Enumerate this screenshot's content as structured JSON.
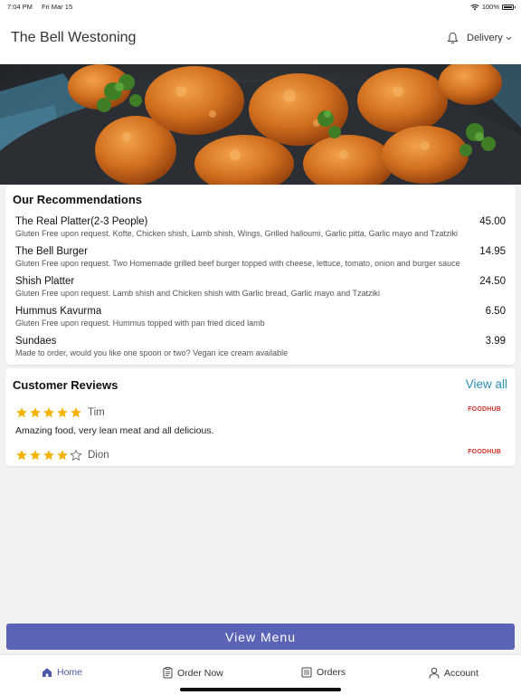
{
  "status_bar": {
    "time": "7:04 PM",
    "date": "Fri Mar 15",
    "battery": "100%"
  },
  "header": {
    "title": "The Bell Westoning",
    "mode": "Delivery"
  },
  "recommendations": {
    "title": "Our Recommendations",
    "items": [
      {
        "name": "The Real Platter(2-3 People)",
        "price": "45.00",
        "desc": "Gluten Free upon request. Kofte, Chicken shish, Lamb shish, Wings, Grilled halloumi, Garlic pitta, Garlic mayo and Tzatziki"
      },
      {
        "name": "The Bell Burger",
        "price": "14.95",
        "desc": "Gluten Free upon request. Two Homemade grilled beef burger topped with cheese, lettuce, tomato, onion and burger sauce"
      },
      {
        "name": "Shish Platter",
        "price": "24.50",
        "desc": "Gluten Free upon request. Lamb shish and Chicken shish with Garlic bread, Garlic mayo and Tzatziki"
      },
      {
        "name": "Hummus Kavurma",
        "price": "6.50",
        "desc": "Gluten Free upon request. Hummus topped with pan fried diced lamb"
      },
      {
        "name": "Sundaes",
        "price": "3.99",
        "desc": "Made to order, would you like one spoon or two? Vegan ice cream available"
      }
    ]
  },
  "reviews": {
    "title": "Customer Reviews",
    "view_all": "View all",
    "items": [
      {
        "name": "Tim",
        "rating": 5,
        "source": "FOODHUB",
        "text": "Amazing food, very lean meat and all delicious."
      },
      {
        "name": "Dion",
        "rating": 4,
        "source": "FOODHUB",
        "text": ""
      }
    ]
  },
  "view_menu_label": "View Menu",
  "tabs": [
    {
      "label": "Home",
      "icon": "home-icon",
      "active": true
    },
    {
      "label": "Order Now",
      "icon": "order-icon",
      "active": false
    },
    {
      "label": "Orders",
      "icon": "orders-icon",
      "active": false
    },
    {
      "label": "Account",
      "icon": "account-icon",
      "active": false
    }
  ],
  "colors": {
    "accent": "#5b63b7",
    "link": "#2a8fb4",
    "star": "#f5b301",
    "active_tab": "#4a5aa8",
    "foodhub": "#d1322a"
  }
}
